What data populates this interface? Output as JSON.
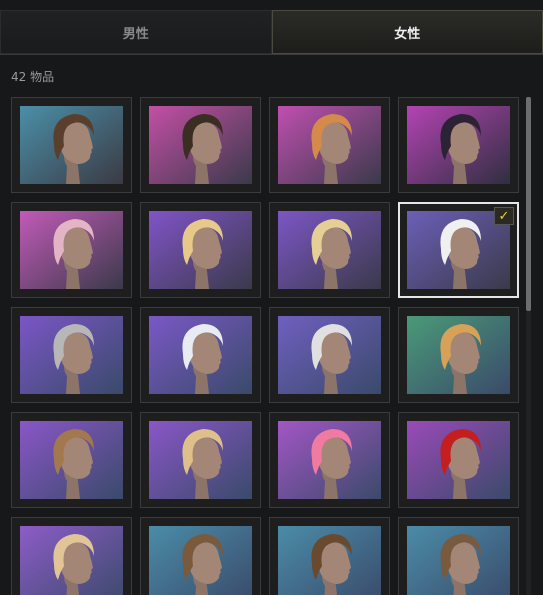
{
  "tabs": [
    {
      "label": "男性",
      "active": false
    },
    {
      "label": "女性",
      "active": true
    }
  ],
  "item_count_label": "42 物品",
  "items": [
    {
      "icon": "curly-updo-hair-icon",
      "bg": [
        "#4a8fa8",
        "#3b3a44"
      ],
      "hair": "#5a3f2c",
      "selected": false
    },
    {
      "icon": "cornrow-braids-hair-icon",
      "bg": [
        "#c44fa6",
        "#3a3a4a"
      ],
      "hair": "#3a2d22",
      "selected": false
    },
    {
      "icon": "short-undercut-hair-icon",
      "bg": [
        "#c04fb0",
        "#3a3a4a"
      ],
      "hair": "#d38a4a",
      "selected": false
    },
    {
      "icon": "short-dark-purple-hair-icon",
      "bg": [
        "#b443b4",
        "#2f2f3f"
      ],
      "hair": "#2b2234",
      "selected": false
    },
    {
      "icon": "pink-braided-long-hair-icon",
      "bg": [
        "#c25ab8",
        "#3a3a4a"
      ],
      "hair": "#e3b4c4",
      "selected": false
    },
    {
      "icon": "blonde-long-wavy-hair-icon",
      "bg": [
        "#8054c8",
        "#3a3a4a"
      ],
      "hair": "#e8c98a",
      "selected": false
    },
    {
      "icon": "blonde-ponytail-bangs-hair-icon",
      "bg": [
        "#7c56c6",
        "#3a3a4a"
      ],
      "hair": "#e6cf94",
      "selected": false
    },
    {
      "icon": "white-bob-hair-icon",
      "bg": [
        "#6b5fb8",
        "#3a3a4a"
      ],
      "hair": "#f0f0f0",
      "selected": true
    },
    {
      "icon": "grey-bob-headband-hair-icon",
      "bg": [
        "#7a56c6",
        "#3a4a6a"
      ],
      "hair": "#b7b7b7",
      "selected": false
    },
    {
      "icon": "white-long-headband-hair-icon",
      "bg": [
        "#7a58c6",
        "#3a4a6a"
      ],
      "hair": "#e8ecf2",
      "selected": false
    },
    {
      "icon": "white-short-bob-hair-icon",
      "bg": [
        "#6f5fc0",
        "#3a4a6a"
      ],
      "hair": "#e0e0e0",
      "selected": false
    },
    {
      "icon": "blonde-high-ponytail-hair-icon",
      "bg": [
        "#4a9a78",
        "#3a4a6a"
      ],
      "hair": "#d7a158",
      "selected": false
    },
    {
      "icon": "brown-braided-crown-hair-icon",
      "bg": [
        "#8a56c8",
        "#3a4a6a"
      ],
      "hair": "#a4784e",
      "selected": false
    },
    {
      "icon": "blonde-space-buns-hair-icon",
      "bg": [
        "#8a56c8",
        "#3a4a6a"
      ],
      "hair": "#e0c08a",
      "selected": false
    },
    {
      "icon": "pink-long-ponytail-hair-icon",
      "bg": [
        "#a356c6",
        "#3a4a6a"
      ],
      "hair": "#f07aa2",
      "selected": false
    },
    {
      "icon": "red-curly-short-hair-icon",
      "bg": [
        "#9a4ab8",
        "#3a4a6a"
      ],
      "hair": "#c41f1f",
      "selected": false
    },
    {
      "icon": "blonde-bun-top-hair-icon",
      "bg": [
        "#8d5cc8",
        "#3a4a6a"
      ],
      "hair": "#e2c596",
      "selected": false
    },
    {
      "icon": "brown-bob-hair-icon",
      "bg": [
        "#4a8ca8",
        "#3a4a6a"
      ],
      "hair": "#7b5a3c",
      "selected": false
    },
    {
      "icon": "brown-curly-hair-icon",
      "bg": [
        "#4a8ca8",
        "#3a4a6a"
      ],
      "hair": "#6a4a2e",
      "selected": false
    },
    {
      "icon": "brown-wavy-long-hair-icon",
      "bg": [
        "#4a8ca8",
        "#3a4a6a"
      ],
      "hair": "#7a5a3e",
      "selected": false
    }
  ],
  "scroll": {
    "position": 0.0,
    "visible_fraction": 0.43
  }
}
